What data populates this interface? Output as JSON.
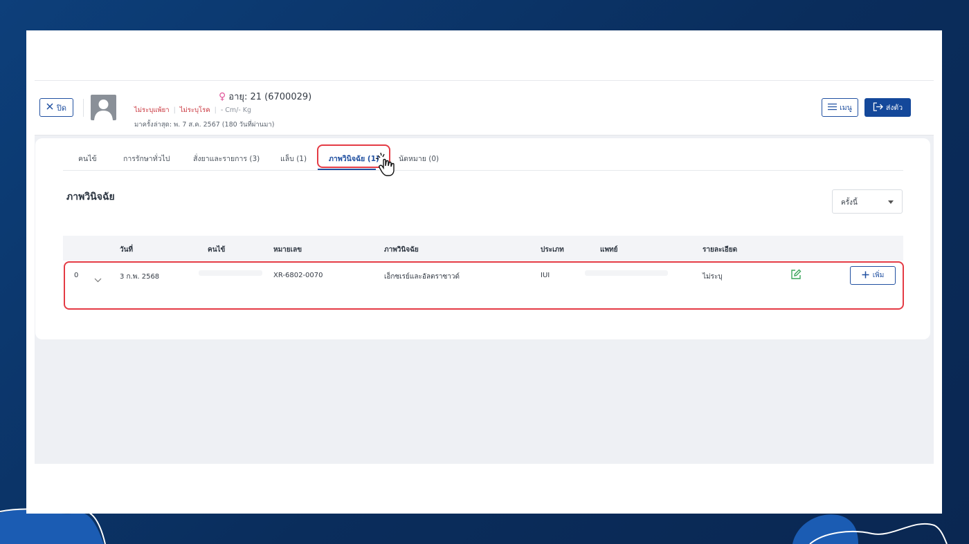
{
  "header": {
    "close_label": "ปิด",
    "age_text": "อายุ: 21 (6700029)",
    "drug_allergy": "ไม่ระบุแพ้ยา",
    "disease": "ไม่ระบุโรค",
    "height_weight": "- Cm/- Kg",
    "last_visit": "มาครั้งล่าสุด: พ. 7 ส.ค. 2567 (180 วันที่ผ่านมา)",
    "menu_label": "เมนู",
    "send_label": "ส่งตัว"
  },
  "tabs": [
    {
      "label": "คนไข้"
    },
    {
      "label": "การรักษาทั่วไป"
    },
    {
      "label": "สั่งยาและรายการ (3)"
    },
    {
      "label": "แล็บ (1)"
    },
    {
      "label": "ภาพวินิจฉัย (1)"
    },
    {
      "label": "นัดหมาย (0)"
    }
  ],
  "section": {
    "title": "ภาพวินิจฉัย",
    "filter_value": "ครั้งนี้"
  },
  "table": {
    "columns": [
      "วันที่",
      "คนไข้",
      "หมายเลข",
      "ภาพวินิจฉัย",
      "ประเภท",
      "แพทย์",
      "รายละเอียด"
    ],
    "rows": [
      {
        "index": "0",
        "date": "3 ก.พ. 2568",
        "number": "XR-6802-0070",
        "imaging": "เอ็กซเรย์และอัลตราซาวด์",
        "type": "IUI",
        "detail": "ไม่ระบุ",
        "add_label": "เพิ่ม"
      }
    ]
  },
  "colors": {
    "accent": "#1f4fa0",
    "highlight": "#e43a44",
    "tag_red": "#c8323a",
    "edit_green": "#3aa55a"
  }
}
